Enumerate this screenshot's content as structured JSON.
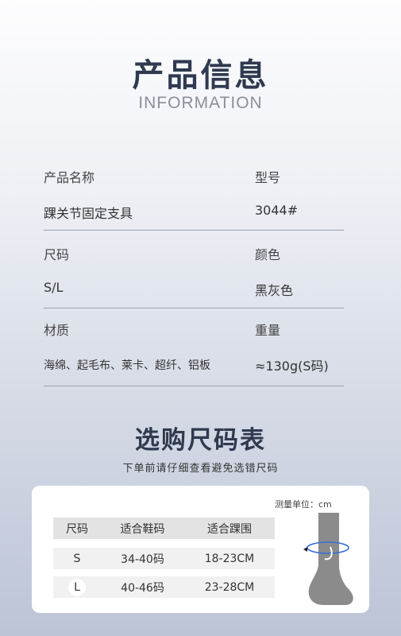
{
  "header": {
    "title": "产品信息",
    "subtitle": "INFORMATION"
  },
  "info": {
    "product_name_label": "产品名称",
    "product_name": "踝关节固定支具",
    "model_label": "型号",
    "model": "3044#",
    "size_label": "尺码",
    "size": "S/L",
    "color_label": "颜色",
    "color": "黑灰色",
    "material_label": "材质",
    "material": "海绵、起毛布、莱卡、超纤、铝板",
    "weight_label": "重量",
    "weight": "≈130g(S码)"
  },
  "size_chart": {
    "title": "选购尺码表",
    "subtitle": "下单前请仔细查看避免选错尺码",
    "unit": "测量单位：cm",
    "headers": [
      "尺码",
      "适合鞋码",
      "适合踝围"
    ],
    "rows": [
      [
        "S",
        "34-40码",
        "18-23CM"
      ],
      [
        "L",
        "40-46码",
        "23-28CM"
      ]
    ]
  },
  "colors": {
    "heading": "#2f3a4f",
    "foot_icon": "#8b8b8b",
    "measure_line": "#3a6fd8"
  }
}
